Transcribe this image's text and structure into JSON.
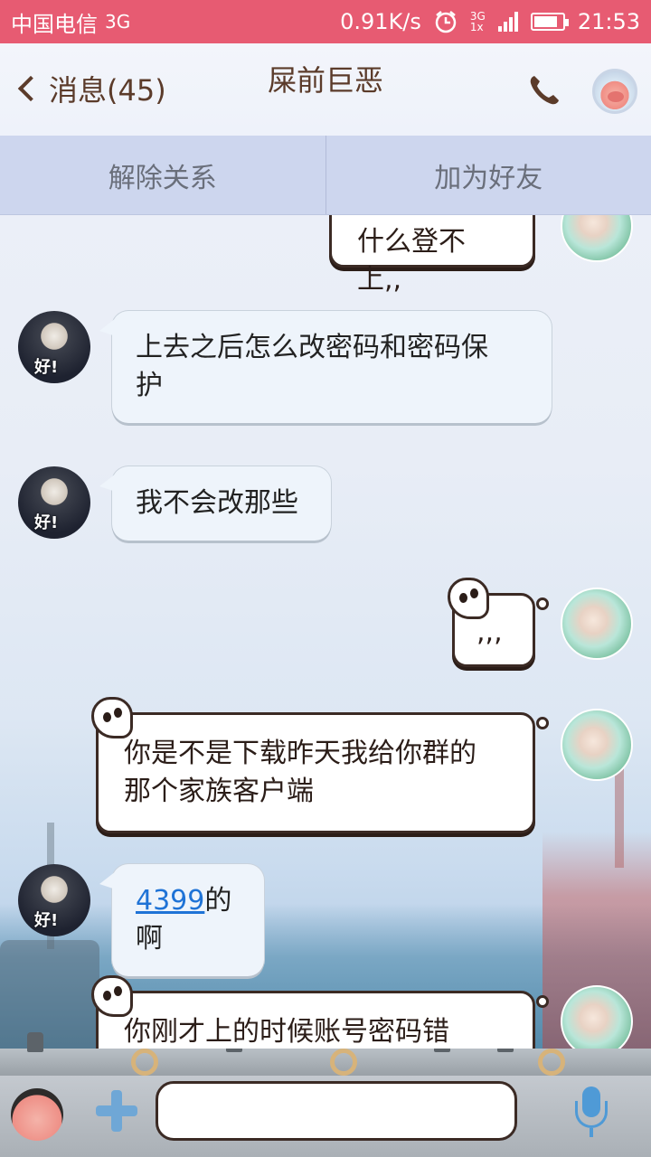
{
  "status_bar": {
    "carrier": "中国电信",
    "network": "3G",
    "speed": "0.91K/s",
    "signal_top": "3G",
    "signal_bottom": "1x",
    "time": "21:53",
    "battery_level": 0.85
  },
  "header": {
    "back_label": "消息(45)",
    "title": "屎前巨恶"
  },
  "actions": {
    "unlink_label": "解除关系",
    "add_friend_label": "加为好友"
  },
  "messages": [
    {
      "side": "right",
      "text": "什么登不上,,"
    },
    {
      "side": "left",
      "text_line1": "上去之后怎么改密码和密码保",
      "text_line2": "护"
    },
    {
      "side": "left",
      "text": "我不会改那些"
    },
    {
      "side": "right",
      "text": ",,,"
    },
    {
      "side": "right",
      "text_line1": "你是不是下载昨天我给你群的",
      "text_line2": "那个家族客户端"
    },
    {
      "side": "left",
      "link": "4399",
      "text": "的啊"
    },
    {
      "side": "right",
      "text": "你刚才上的时候账号密码错"
    }
  ],
  "avatar_left_tag": "好!",
  "input": {
    "value": ""
  }
}
